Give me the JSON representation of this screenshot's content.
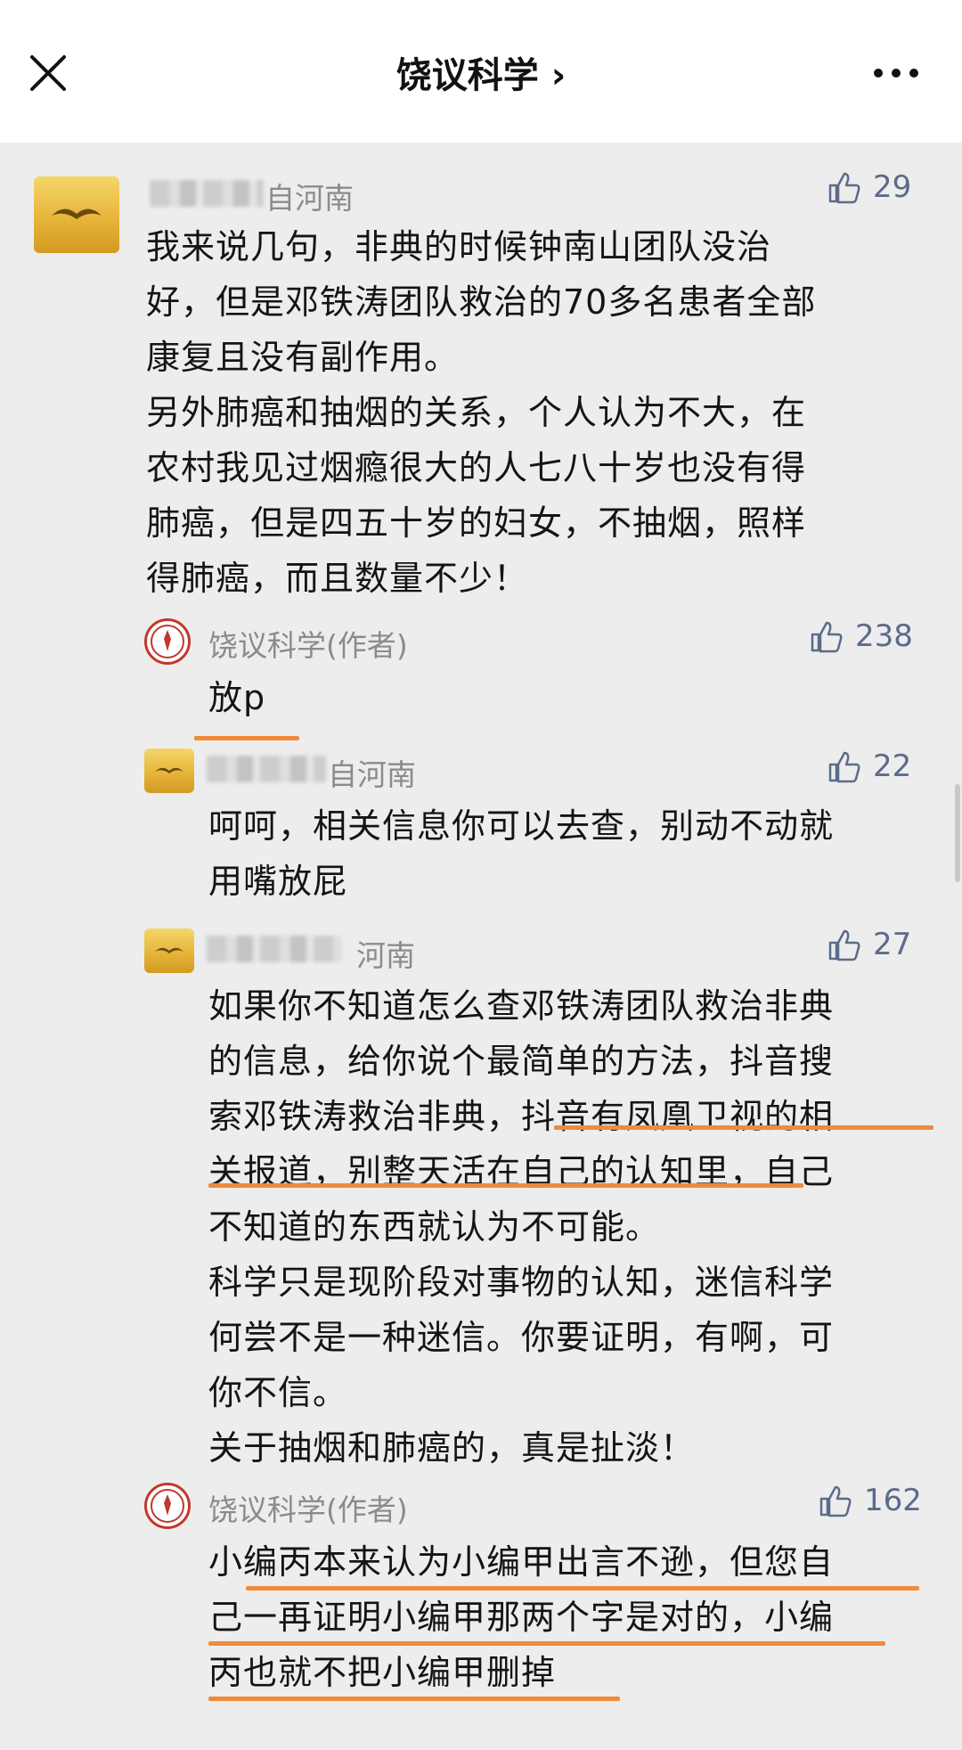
{
  "header": {
    "title": "饶议科学 ›",
    "close_icon": "close-icon",
    "more_icon": "more-icon"
  },
  "comments": [
    {
      "name": "自河南",
      "likes": "29",
      "text": "我来说几句，非典的时候钟南山团队没治\n好，但是邓铁涛团队救治的70多名患者全部\n康复且没有副作用。\n另外肺癌和抽烟的关系，个人认为不大，在\n农村我见过烟瘾很大的人七八十岁也没有得\n肺癌，但是四五十岁的妇女，不抽烟，照样\n得肺癌，而且数量不少！"
    },
    {
      "name": "饶议科学(作者)",
      "likes": "238",
      "text": "放p"
    },
    {
      "name": "自河南",
      "likes": "22",
      "text": "呵呵，相关信息你可以去查，别动不动就\n用嘴放屁"
    },
    {
      "name": "河南",
      "likes": "27",
      "text": "如果你不知道怎么查邓铁涛团队救治非典\n的信息，给你说个最简单的方法，抖音搜\n索邓铁涛救治非典，抖音有凤凰卫视的相\n关报道，别整天活在自己的认知里，自己\n不知道的东西就认为不可能。\n科学只是现阶段对事物的认知，迷信科学\n何尝不是一种迷信。你要证明，有啊，可\n你不信。\n关于抽烟和肺癌的，真是扯淡！"
    },
    {
      "name": "饶议科学(作者)",
      "likes": "162",
      "text": "小编丙本来认为小编甲出言不逊，但您自\n己一再证明小编甲那两个字是对的，小编\n丙也就不把小编甲删掉"
    }
  ],
  "colors": {
    "underline": "#f08a3c",
    "like": "#5b6b8a",
    "name": "#8b8b8b"
  }
}
